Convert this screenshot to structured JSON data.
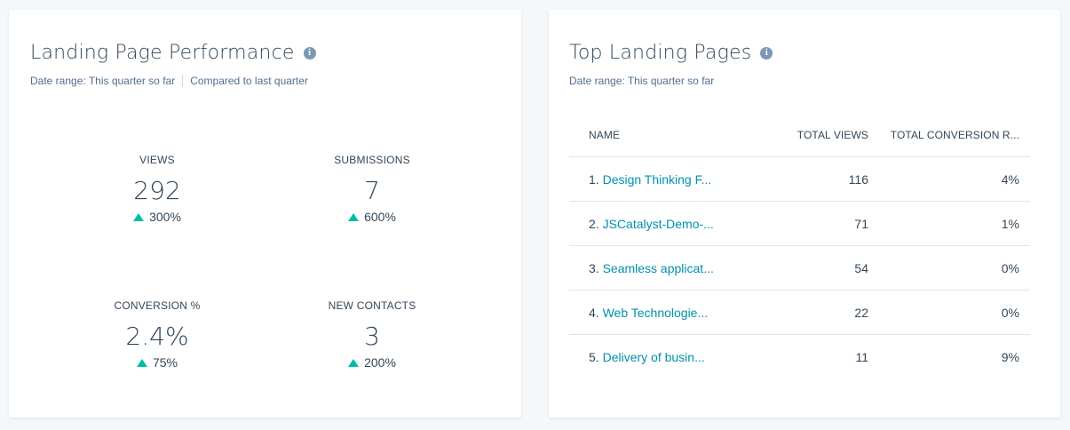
{
  "left_card": {
    "title": "Landing Page Performance",
    "info_icon_glyph": "i",
    "date_range": "Date range:  This quarter so far",
    "comparison": "Compared to last quarter",
    "kpis": {
      "views": {
        "label": "VIEWS",
        "value": "292",
        "change": "300%"
      },
      "submissions": {
        "label": "SUBMISSIONS",
        "value": "7",
        "change": "600%"
      },
      "conversion": {
        "label": "CONVERSION %",
        "value": "2.4%",
        "change": "75%"
      },
      "new_contacts": {
        "label": "NEW CONTACTS",
        "value": "3",
        "change": "200%"
      }
    }
  },
  "right_card": {
    "title": "Top Landing Pages",
    "info_icon_glyph": "i",
    "date_range": "Date range:  This quarter so far",
    "table": {
      "headers": {
        "name": "NAME",
        "views": "TOTAL VIEWS",
        "conversion": "TOTAL CONVERSION R..."
      },
      "rows": [
        {
          "index": "1.",
          "name": "Design Thinking F...",
          "views": "116",
          "conversion": "4%"
        },
        {
          "index": "2.",
          "name": "JSCatalyst-Demo-...",
          "views": "71",
          "conversion": "1%"
        },
        {
          "index": "3.",
          "name": "Seamless applicat...",
          "views": "54",
          "conversion": "0%"
        },
        {
          "index": "4.",
          "name": "Web Technologie...",
          "views": "22",
          "conversion": "0%"
        },
        {
          "index": "5.",
          "name": "Delivery of busin...",
          "views": "11",
          "conversion": "9%"
        }
      ]
    }
  },
  "colors": {
    "background": "#f5f8fa",
    "card": "#ffffff",
    "text": "#33475b",
    "muted_text": "#516f90",
    "link": "#0091ae",
    "positive": "#00bda5",
    "info_icon": "#7c98b6",
    "divider": "#dfe3eb"
  },
  "icons": {
    "info": "info-circle-icon",
    "trend_up": "triangle-up-icon"
  }
}
